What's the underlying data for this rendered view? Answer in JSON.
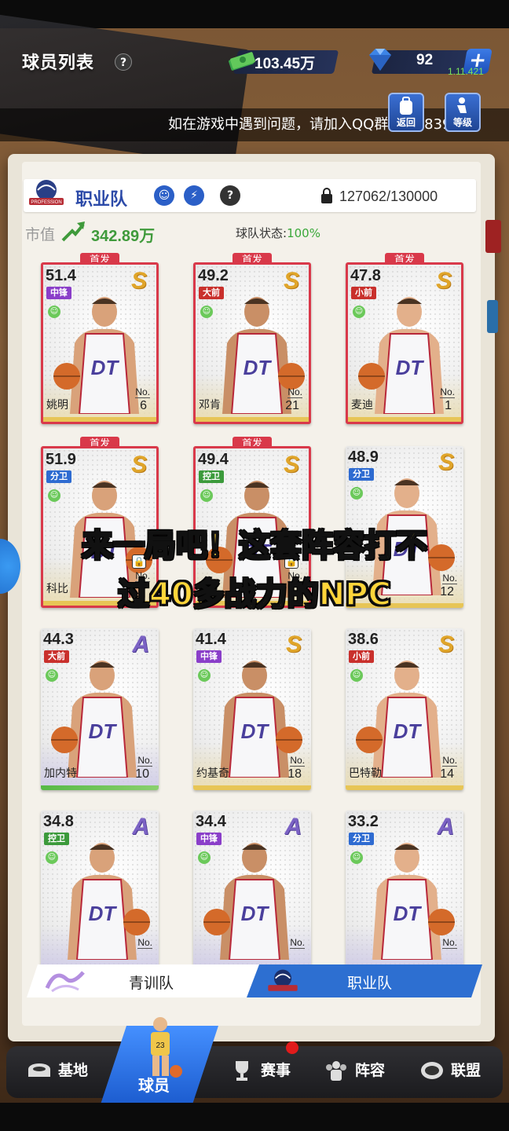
{
  "header": {
    "title": "球员列表",
    "help": "?",
    "money": "103.45万",
    "gems": "92",
    "plus": "+",
    "version": "1.11.421",
    "side_buttons": [
      {
        "label": "返回",
        "icon": "backpack-icon"
      },
      {
        "label": "等级",
        "icon": "seat-icon"
      }
    ],
    "marquee": "如在游戏中遇到问题，请加入QQ群992483979"
  },
  "team": {
    "logo_text": "PROFESSION",
    "name": "职业队",
    "cap": "127062/130000",
    "market_value_label": "市值",
    "market_value": "342.89万",
    "status_label": "球队状态:",
    "status_value": "100%"
  },
  "cards": [
    {
      "rating": "51.4",
      "grade": "S",
      "pos": "中锋",
      "pos_color": "#8a3ec9",
      "name": "姚明",
      "no": "6",
      "starter": true,
      "starter_label": "首发"
    },
    {
      "rating": "49.2",
      "grade": "S",
      "pos": "大前",
      "pos_color": "#c9302c",
      "name": "邓肯",
      "no": "21",
      "starter": true,
      "starter_label": "首发"
    },
    {
      "rating": "47.8",
      "grade": "S",
      "pos": "小前",
      "pos_color": "#c9302c",
      "name": "麦迪",
      "no": "1",
      "starter": true,
      "starter_label": "首发"
    },
    {
      "rating": "51.9",
      "grade": "S",
      "pos": "分卫",
      "pos_color": "#2e6bd1",
      "name": "科比",
      "no": "",
      "starter": true,
      "starter_label": "首发"
    },
    {
      "rating": "49.4",
      "grade": "S",
      "pos": "控卫",
      "pos_color": "#3b9a3b",
      "name": "",
      "no": "",
      "starter": true,
      "starter_label": "首发"
    },
    {
      "rating": "48.9",
      "grade": "S",
      "pos": "分卫",
      "pos_color": "#2e6bd1",
      "name": "",
      "no": "12",
      "starter": false,
      "starter_label": ""
    },
    {
      "rating": "44.3",
      "grade": "A",
      "pos": "大前",
      "pos_color": "#c9302c",
      "name": "加内特",
      "no": "10",
      "starter": false,
      "starter_label": ""
    },
    {
      "rating": "41.4",
      "grade": "S",
      "pos": "中锋",
      "pos_color": "#8a3ec9",
      "name": "约基奇",
      "no": "18",
      "starter": false,
      "starter_label": ""
    },
    {
      "rating": "38.6",
      "grade": "S",
      "pos": "小前",
      "pos_color": "#c9302c",
      "name": "巴特勒",
      "no": "14",
      "starter": false,
      "starter_label": ""
    },
    {
      "rating": "34.8",
      "grade": "A",
      "pos": "控卫",
      "pos_color": "#3b9a3b",
      "name": "",
      "no": "",
      "starter": false,
      "starter_label": ""
    },
    {
      "rating": "34.4",
      "grade": "A",
      "pos": "中锋",
      "pos_color": "#8a3ec9",
      "name": "",
      "no": "",
      "starter": false,
      "starter_label": ""
    },
    {
      "rating": "33.2",
      "grade": "A",
      "pos": "分卫",
      "pos_color": "#2e6bd1",
      "name": "",
      "no": "",
      "starter": false,
      "starter_label": ""
    }
  ],
  "no_label": "No.",
  "caption": {
    "line1": "来一局吧！这套阵容打不",
    "line2": "过40多战力的NPC"
  },
  "tabs": {
    "youth": "青训队",
    "pro": "职业队"
  },
  "nav": {
    "base": "基地",
    "players": "球员",
    "events": "赛事",
    "lineup": "阵容",
    "league": "联盟"
  }
}
